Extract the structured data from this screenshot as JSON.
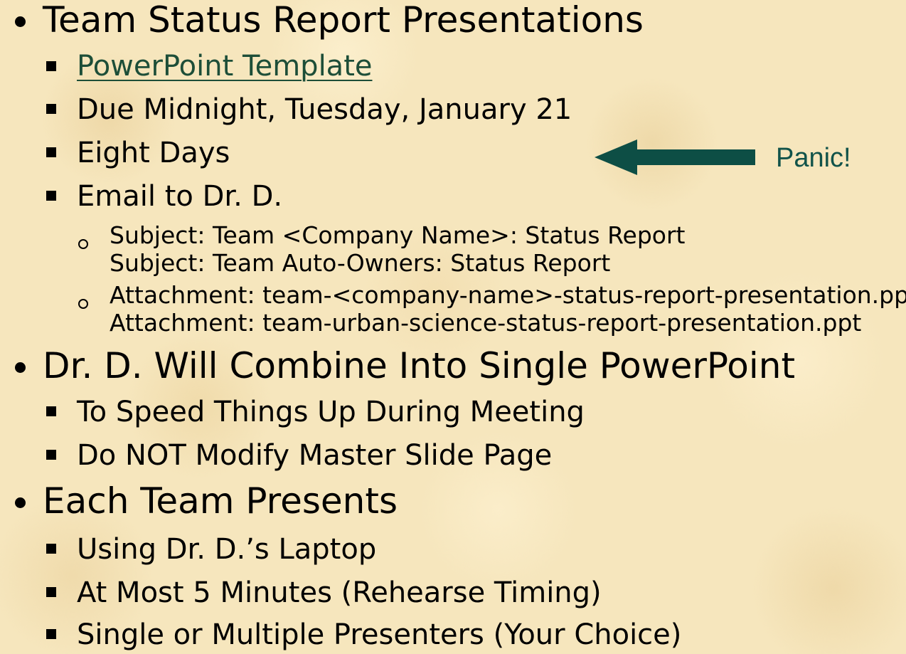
{
  "items": [
    {
      "level": 1,
      "text": "Team Status Report Presentations"
    },
    {
      "level": 2,
      "text": "PowerPoint Template",
      "link": true
    },
    {
      "level": 2,
      "text": "Due Midnight, Tuesday, January 21"
    },
    {
      "level": 2,
      "text": "Eight Days"
    },
    {
      "level": 2,
      "text": "Email to Dr. D."
    },
    {
      "level": 3,
      "text": "Subject:  Team <Company Name>: Status Report"
    },
    {
      "level": 3,
      "text": "Subject:   Team Auto-Owners: Status Report",
      "continuation": true
    },
    {
      "level": 3,
      "text": "Attachment:  team-<company-name>-status-report-presentation.ppt"
    },
    {
      "level": 3,
      "text": "Attachment:  team-urban-science-status-report-presentation.ppt",
      "continuation": true
    },
    {
      "level": 1,
      "text": "Dr. D. Will Combine Into Single PowerPoint"
    },
    {
      "level": 2,
      "text": "To Speed Things Up During Meeting"
    },
    {
      "level": 2,
      "text": "Do NOT Modify Master Slide Page"
    },
    {
      "level": 1,
      "text": "Each Team Presents"
    },
    {
      "level": 2,
      "text": "Using Dr. D.’s Laptop"
    },
    {
      "level": 2,
      "text": "At Most 5 Minutes (Rehearse Timing)"
    },
    {
      "level": 2,
      "text": "Single or Multiple Presenters (Your Choice)"
    }
  ],
  "callout": {
    "text": "Panic!",
    "arrow_icon": "left-arrow-icon",
    "color": "#11534a"
  },
  "colors": {
    "background": "#f6e6bd",
    "link": "#1d4e38",
    "text": "#000000"
  }
}
